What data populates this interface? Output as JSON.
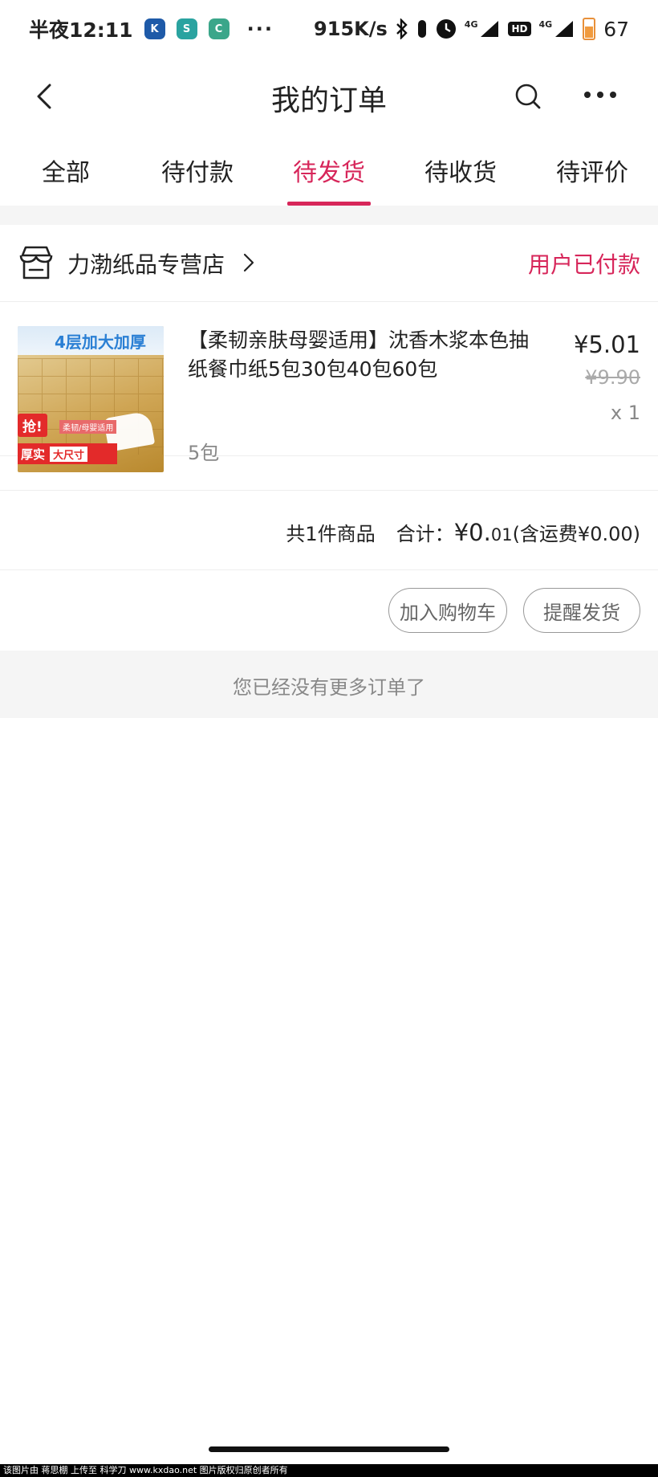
{
  "status_bar": {
    "time": "半夜12:11",
    "app_icons": [
      "K",
      "S",
      "C"
    ],
    "overflow": "···",
    "net_speed": "915K/s",
    "network_1": "4G",
    "hd": "HD",
    "network_2": "4G",
    "battery": "67"
  },
  "header": {
    "title": "我的订单"
  },
  "tabs": [
    {
      "label": "全部",
      "active": false
    },
    {
      "label": "待付款",
      "active": false
    },
    {
      "label": "待发货",
      "active": true
    },
    {
      "label": "待收货",
      "active": false
    },
    {
      "label": "待评价",
      "active": false
    }
  ],
  "order": {
    "store_name": "力渤纸品专营店",
    "status": "用户已付款",
    "item": {
      "thumb_title": "4层加大加厚",
      "thumb_badge": "抢!",
      "thumb_sub": "柔韧/母婴适用",
      "thumb_tag_a": "厚实",
      "thumb_tag_b": "大尺寸",
      "title": "【柔韧亲肤母婴适用】沈香木浆本色抽纸餐巾纸5包30包40包60包",
      "spec": "5包",
      "price": "¥5.01",
      "original_price": "¥9.90",
      "quantity": "x 1"
    },
    "summary": {
      "count": "共1件商品",
      "total_label": "合计：",
      "total_big": "¥0.",
      "total_small": "01",
      "shipping": "(含运费¥0.00)"
    },
    "actions": {
      "add_cart": "加入购物车",
      "remind": "提醒发货"
    }
  },
  "no_more": "您已经没有更多订单了",
  "footer_note": "该图片由 蒋思棚 上传至 科学刀 www.kxdao.net 图片版权归原创者所有",
  "colors": {
    "accent": "#d7265a",
    "gray_bg": "#f5f5f5"
  }
}
